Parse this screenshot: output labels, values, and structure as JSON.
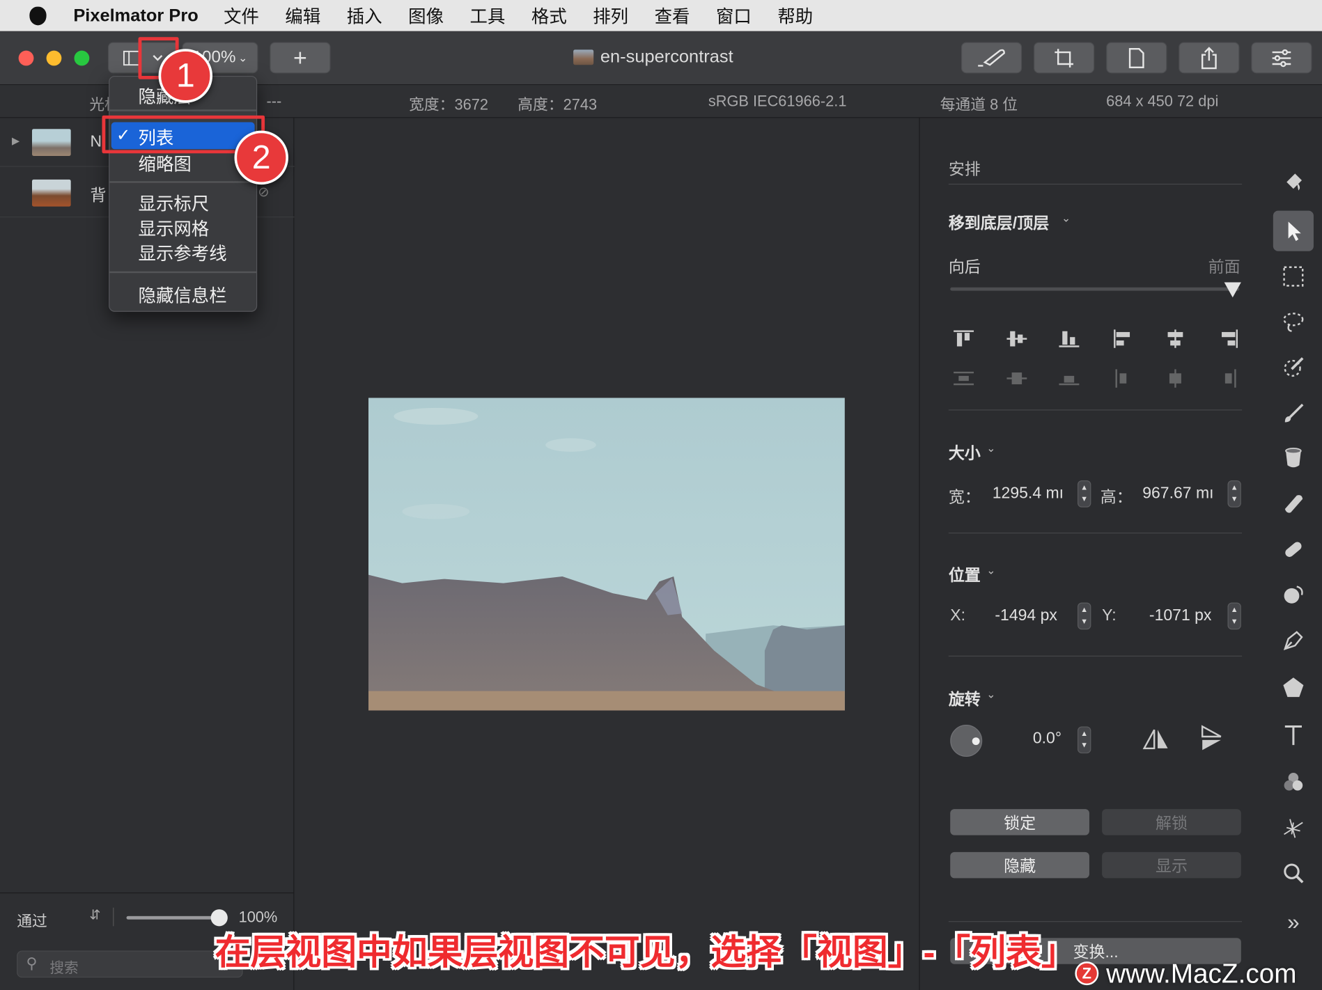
{
  "menubar": {
    "app_name": "Pixelmator Pro",
    "items": [
      "文件",
      "编辑",
      "插入",
      "图像",
      "工具",
      "格式",
      "排列",
      "查看",
      "窗口",
      "帮助"
    ]
  },
  "toolbar": {
    "zoom": "100%",
    "document_title": "en-supercontrast",
    "add_label": "+"
  },
  "infobar": {
    "cursor_label": "光标",
    "cursor_value": "---",
    "width": "宽度：3672",
    "height": "高度：2743",
    "color_profile": "sRGB IEC61966-2.1",
    "bit_depth": "每通道 8 位",
    "resolution": "684 x 450 72 dpi"
  },
  "layers": [
    {
      "name": "N"
    },
    {
      "name": "背"
    }
  ],
  "view_menu": {
    "items": [
      {
        "label": "隐藏层"
      },
      {
        "label": "列表",
        "checked": true
      },
      {
        "label": "缩略图"
      },
      {
        "label": "显示标尺"
      },
      {
        "label": "显示网格"
      },
      {
        "label": "显示参考线"
      },
      {
        "label": "隐藏信息栏"
      }
    ]
  },
  "annotations": {
    "badge1": "1",
    "badge2": "2"
  },
  "layers_footer": {
    "blend_mode": "通过",
    "opacity": "100%",
    "opacity_value": 1.0,
    "search_placeholder": "搜索"
  },
  "arrange_panel": {
    "title": "安排",
    "move_section": "移到底层/顶层",
    "backward": "向后",
    "forward": "前面",
    "order_slider_value": 1.0,
    "size_section": "大小",
    "width_label": "宽：",
    "width_value": "1295.4 mı",
    "height_label": "高：",
    "height_value": "967.67 mı",
    "position_section": "位置",
    "x_label": "X:",
    "x_value": "-1494 px",
    "y_label": "Y:",
    "y_value": "-1071 px",
    "rotate_section": "旋转",
    "rotate_value": "0.0°",
    "lock": "锁定",
    "unlock": "解锁",
    "hide": "隐藏",
    "show": "显示",
    "transform": "变换..."
  },
  "tools": [
    "paint-bucket-icon",
    "arrow-select-icon",
    "rect-select-icon",
    "lasso-icon",
    "quick-select-icon",
    "brush-icon",
    "fill-icon",
    "eraser-icon",
    "bandage-icon",
    "blob-icon",
    "pen-icon",
    "shape-icon",
    "text-icon",
    "color-adjust-icon",
    "distort-icon",
    "zoom-icon",
    "more-icon"
  ],
  "caption": "在层视图中如果层视图不可见，选择「视图」-「列表」",
  "watermark": "www.MacZ.com",
  "colors": {
    "accent": "#1a64d8",
    "annotation_red": "#e8363a"
  }
}
